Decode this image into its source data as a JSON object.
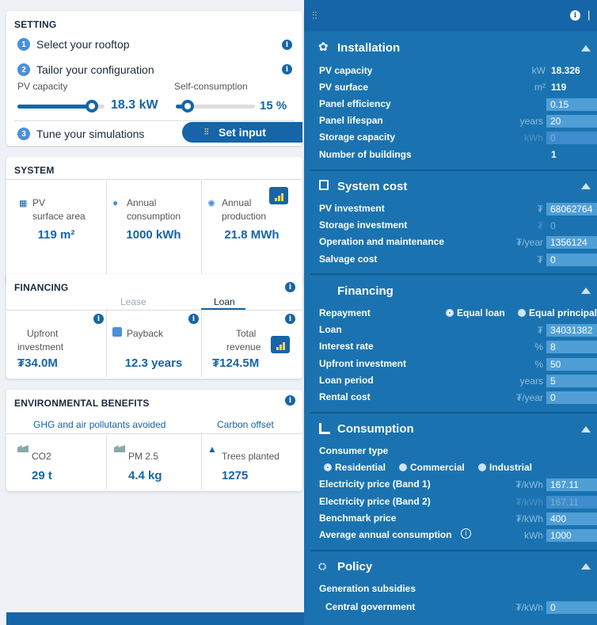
{
  "setting": {
    "title": "SETTING",
    "step1": "Select your rooftop",
    "step2": "Tailor your configuration",
    "step3": "Tune your simulations",
    "pv_capacity_label": "PV capacity",
    "pv_capacity_value": "18.3 kW",
    "pv_capacity_fraction": 0.85,
    "self_consumption_label": "Self-consumption",
    "self_consumption_value": "15 %",
    "self_consumption_fraction": 0.15,
    "set_input": "Set input",
    "n1": "1",
    "n2": "2",
    "n3": "3"
  },
  "system": {
    "title": "SYSTEM",
    "c1_l1": "PV",
    "c1_l2": "surface area",
    "c1_val": "119 m²",
    "c2_l1": "Annual",
    "c2_l2": "consumption",
    "c2_val": "1000 kWh",
    "c3_l1": "Annual",
    "c3_l2": "production",
    "c3_val": "21.8 MWh"
  },
  "financing": {
    "title": "FINANCING",
    "tab_lease": "Lease",
    "tab_loan": "Loan",
    "c1_l1": "Upfront",
    "c1_l2": "investment",
    "c1_val": "₮34.0M",
    "c2_l1": "Payback",
    "c2_val": "12.3 years",
    "c3_l1": "Total",
    "c3_l2": "revenue",
    "c3_val": "₮124.5M"
  },
  "env": {
    "title": "ENVIRONMENTAL BENEFITS",
    "tab1": "GHG and air pollutants avoided",
    "tab2": "Carbon offset",
    "c1_l": "CO2",
    "c1_val": "29 t",
    "c2_l": "PM 2.5",
    "c2_val": "4.4 kg",
    "c3_l": "Trees planted",
    "c3_val": "1275"
  },
  "installation": {
    "title": "Installation",
    "pv_capacity": "PV capacity",
    "pv_capacity_unit": "kW",
    "pv_capacity_val": "18.326",
    "pv_surface": "PV surface",
    "pv_surface_unit": "m²",
    "pv_surface_val": "119",
    "panel_eff": "Panel efficiency",
    "panel_eff_val": "0.15",
    "panel_life": "Panel lifespan",
    "panel_life_unit": "years",
    "panel_life_val": "20",
    "storage": "Storage capacity",
    "storage_unit": "kWh",
    "storage_val": "0",
    "buildings": "Number of buildings",
    "buildings_val": "1"
  },
  "system_cost": {
    "title": "System cost",
    "pv_inv": "PV investment",
    "pv_inv_unit": "₮",
    "pv_inv_val": "68062764",
    "storage_inv": "Storage investment",
    "storage_inv_unit": "₮",
    "storage_inv_val": "0",
    "om": "Operation and maintenance",
    "om_unit": "₮/year",
    "om_val": "1356124",
    "salvage": "Salvage cost",
    "salvage_unit": "₮",
    "salvage_val": "0"
  },
  "fin_panel": {
    "title": "Financing",
    "repayment": "Repayment",
    "opt1": "Equal loan",
    "opt2": "Equal principal",
    "loan": "Loan",
    "loan_unit": "₮",
    "loan_val": "34031382",
    "interest": "Interest rate",
    "interest_unit": "%",
    "interest_val": "8",
    "upfront": "Upfront investment",
    "upfront_unit": "%",
    "upfront_val": "50",
    "period": "Loan period",
    "period_unit": "years",
    "period_val": "5",
    "rental": "Rental cost",
    "rental_unit": "₮/year",
    "rental_val": "0"
  },
  "consumption": {
    "title": "Consumption",
    "consumer_type": "Consumer type",
    "opt1": "Residential",
    "opt2": "Commercial",
    "opt3": "Industrial",
    "band1": "Electricity price (Band 1)",
    "band1_unit": "₮/kWh",
    "band1_val": "167.11",
    "band2": "Electricity price (Band 2)",
    "band2_unit": "₮/kWh",
    "band2_val": "167.11",
    "bench": "Benchmark price",
    "bench_unit": "₮/kWh",
    "bench_val": "400",
    "avg": "Average annual consumption",
    "avg_unit": "kWh",
    "avg_val": "1000"
  },
  "policy": {
    "title": "Policy",
    "gen_sub": "Generation subsidies",
    "central": "Central government",
    "central_unit": "₮/kWh",
    "central_val": "0"
  },
  "topbar": {
    "info": "i",
    "sep": "|"
  }
}
